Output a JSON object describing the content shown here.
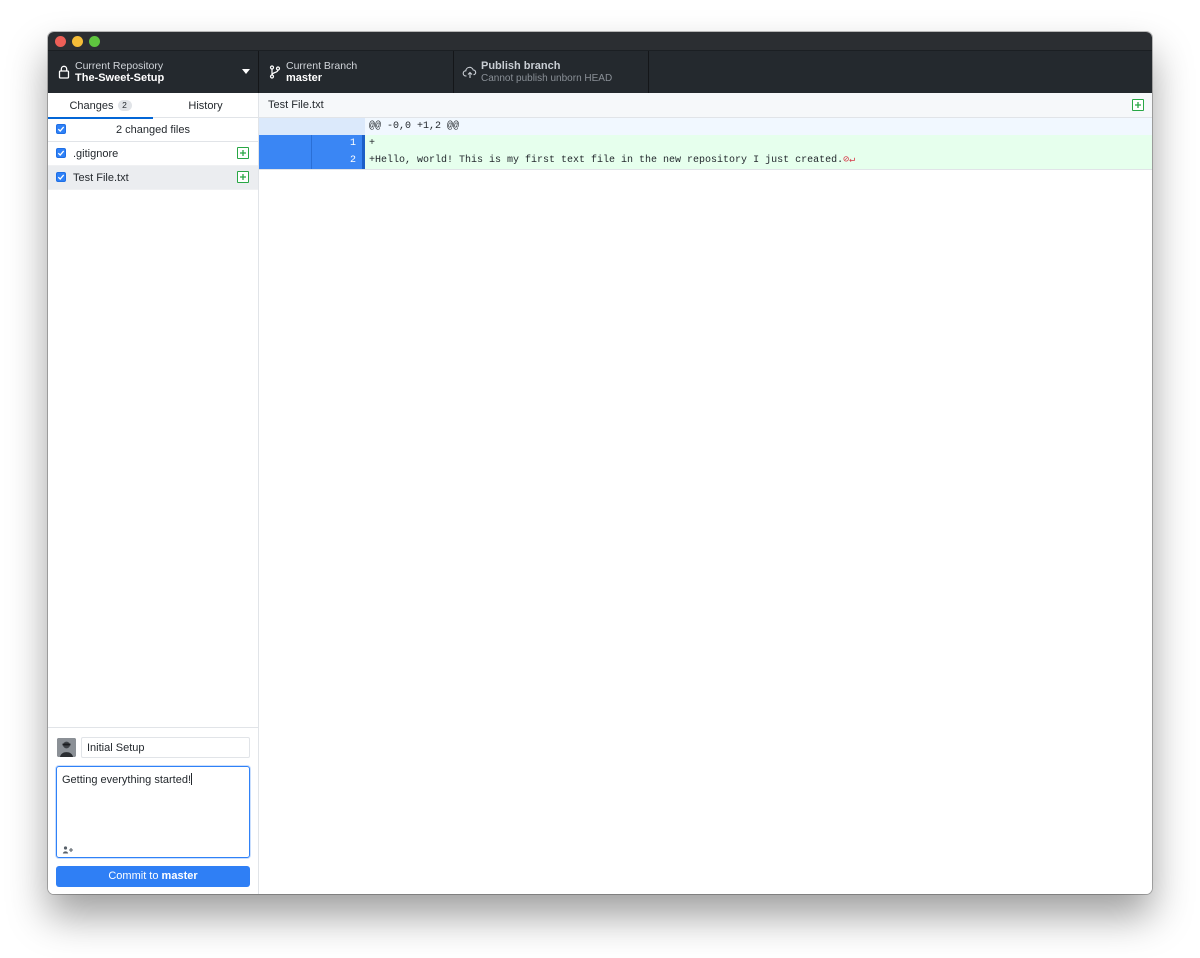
{
  "toolbar": {
    "repository": {
      "label": "Current Repository",
      "value": "The-Sweet-Setup",
      "icon": "lock-icon"
    },
    "branch": {
      "label": "Current Branch",
      "value": "master",
      "icon": "git-branch-icon"
    },
    "publish": {
      "label": "Publish branch",
      "value": "Cannot publish unborn HEAD",
      "icon": "cloud-upload-icon"
    }
  },
  "sidebar": {
    "tabs": [
      {
        "label": "Changes",
        "count": "2",
        "active": true
      },
      {
        "label": "History",
        "active": false
      }
    ],
    "changes_header": "2 changed files",
    "files": [
      {
        "name": ".gitignore",
        "checked": true,
        "status": "added"
      },
      {
        "name": "Test File.txt",
        "checked": true,
        "status": "added",
        "selected": true
      }
    ]
  },
  "commit": {
    "summary": "Initial Setup",
    "description": "Getting everything started!",
    "button_prefix": "Commit to ",
    "button_branch": "master"
  },
  "diff": {
    "file": "Test File.txt",
    "hunk_header": "@@ -0,0 +1,2 @@",
    "lines": [
      {
        "new_num": "1",
        "text": "+"
      },
      {
        "new_num": "2",
        "text": "+Hello, world! This is my first text file in the new repository I just created."
      }
    ],
    "no_newline_marker": "⊘↵"
  },
  "colors": {
    "accent": "#2f7ff5",
    "toolbar_bg": "#24292e",
    "added_bg": "#e6ffed",
    "added_icon": "#28a745"
  }
}
